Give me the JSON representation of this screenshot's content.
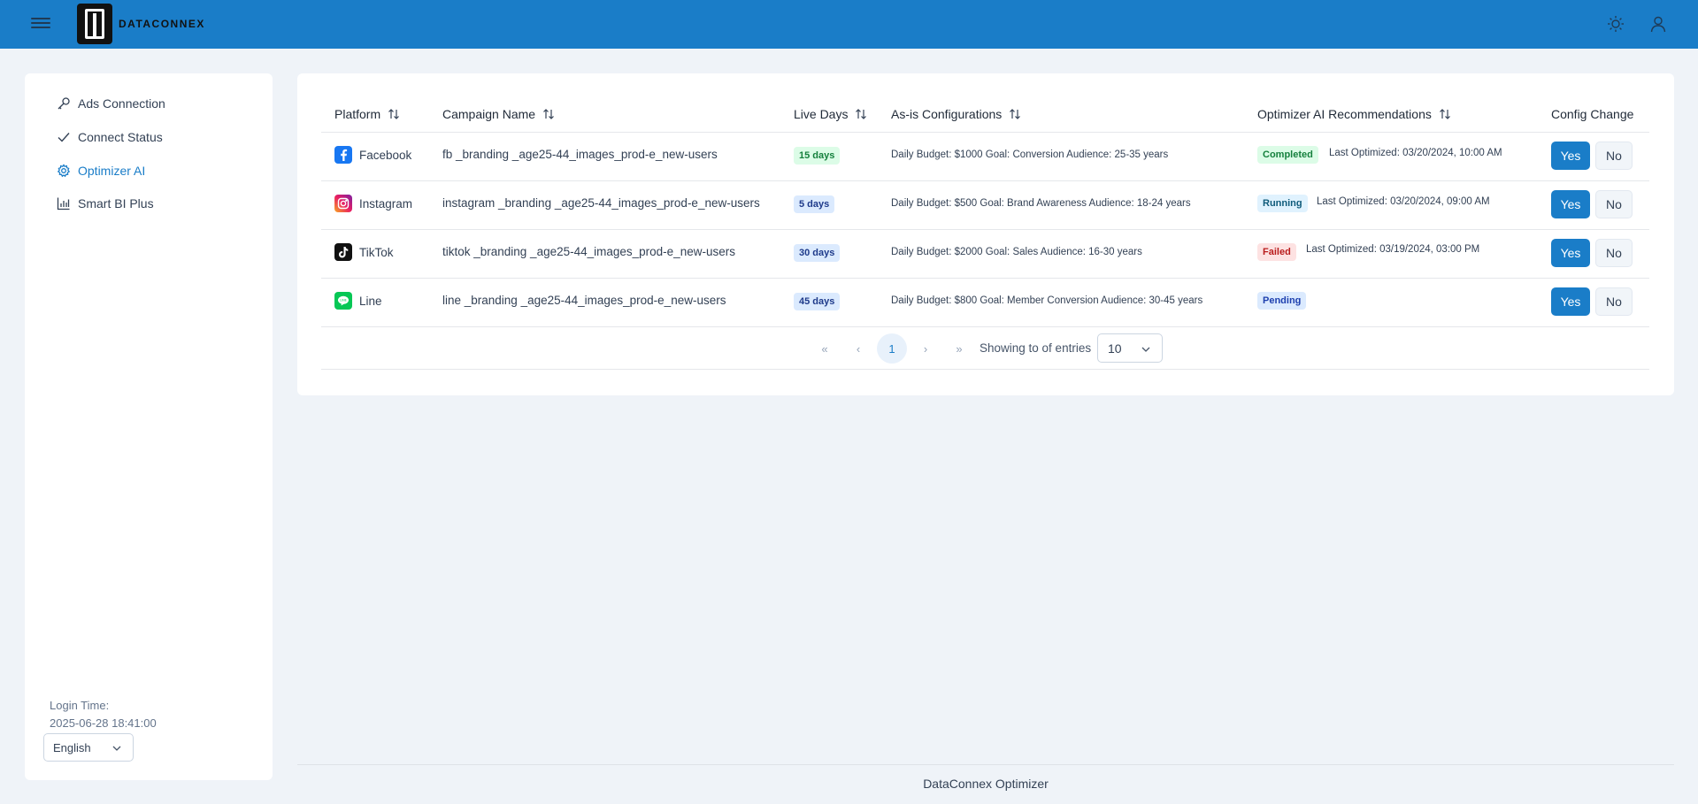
{
  "header": {
    "brand": "DATACONNEX",
    "menu_icon": "hamburger-menu-icon",
    "theme_icon": "sun-icon",
    "user_icon": "user-icon"
  },
  "sidebar": {
    "items": [
      {
        "label": "Ads Connection",
        "icon": "key-icon",
        "active": false
      },
      {
        "label": "Connect Status",
        "icon": "check-icon",
        "active": false
      },
      {
        "label": "Optimizer AI",
        "icon": "gear-icon",
        "active": true
      },
      {
        "label": "Smart BI Plus",
        "icon": "bar-chart-icon",
        "active": false
      }
    ],
    "login_label": "Login Time:",
    "login_time": "2025-06-28 18:41:00",
    "language": "English"
  },
  "table": {
    "headers": {
      "platform": "Platform",
      "campaign": "Campaign Name",
      "live_days": "Live Days",
      "config": "As-is Configurations",
      "recommendations": "Optimizer AI Recommendations",
      "config_change": "Config Change"
    },
    "rows": [
      {
        "platform": "Facebook",
        "icon": "facebook-icon",
        "campaign": "fb _branding _age25-44_images_prod-e_new-users",
        "days": "15 days",
        "config": "Daily Budget: $1000 Goal: Conversion Audience: 25-35 years",
        "status": "Completed",
        "last_optimized": "Last Optimized: 03/20/2024, 10:00 AM",
        "yes": "Yes",
        "no": "No"
      },
      {
        "platform": "Instagram",
        "icon": "instagram-icon",
        "campaign": "instagram _branding _age25-44_images_prod-e_new-users",
        "days": "5 days",
        "config": "Daily Budget: $500 Goal: Brand Awareness Audience: 18-24 years",
        "status": "Running",
        "last_optimized": "Last Optimized: 03/20/2024, 09:00 AM",
        "yes": "Yes",
        "no": "No"
      },
      {
        "platform": "TikTok",
        "icon": "tiktok-icon",
        "campaign": "tiktok _branding _age25-44_images_prod-e_new-users",
        "days": "30 days",
        "config": "Daily Budget: $2000 Goal: Sales Audience: 16-30 years",
        "status": "Failed",
        "last_optimized": "Last Optimized: 03/19/2024, 03:00 PM",
        "yes": "Yes",
        "no": "No"
      },
      {
        "platform": "Line",
        "icon": "line-icon",
        "campaign": "line _branding _age25-44_images_prod-e_new-users",
        "days": "45 days",
        "config": "Daily Budget: $800 Goal: Member Conversion Audience: 30-45 years",
        "status": "Pending",
        "last_optimized": "",
        "yes": "Yes",
        "no": "No"
      }
    ]
  },
  "pagination": {
    "first": "«",
    "prev": "‹",
    "current_page": "1",
    "next": "›",
    "last": "»",
    "showing_text": "Showing to of entries",
    "page_size": "10"
  },
  "footer": {
    "text": "DataConnex Optimizer"
  },
  "colors": {
    "primary": "#1a7dc8",
    "background": "#eff3f8"
  }
}
